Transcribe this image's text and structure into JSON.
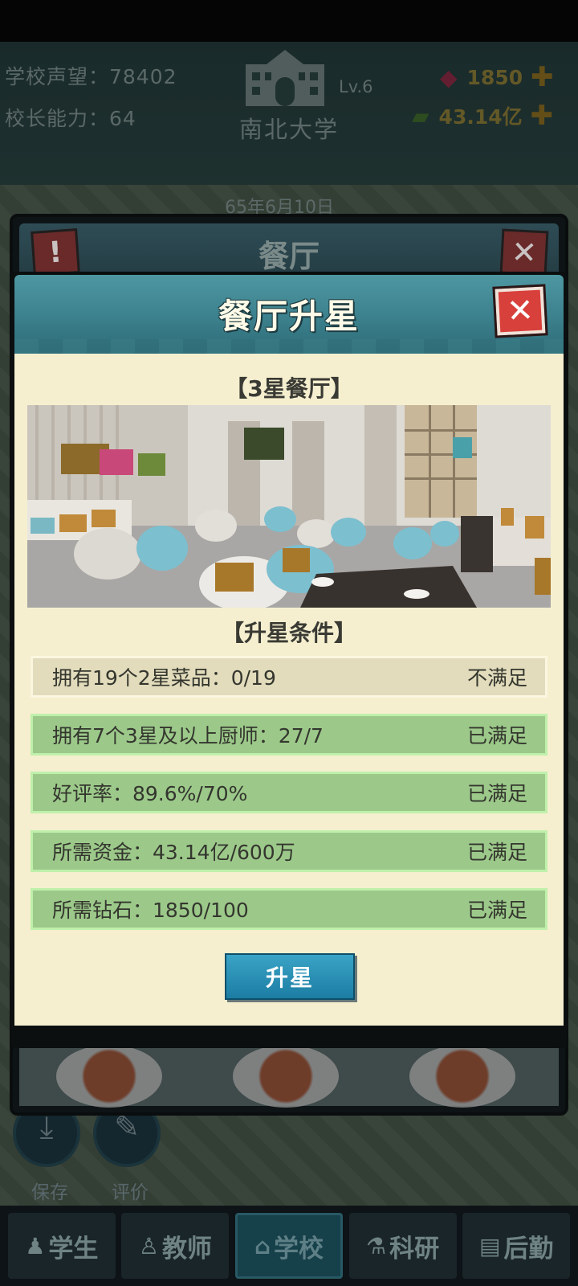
{
  "hud": {
    "reputation": "学校声望：78402",
    "principal_ability": "校长能力：64",
    "school_level": "Lv.6",
    "school_name": "南北大学",
    "diamonds": "1850",
    "money": "43.14亿",
    "date": "65年6月10日"
  },
  "side_buttons": {
    "save_label": "保存",
    "rate_label": "评价"
  },
  "parent_panel": {
    "title": "餐厅",
    "alert_glyph": "!",
    "close_glyph": "✕"
  },
  "modal": {
    "title": "餐厅升星",
    "close_glyph": "✕",
    "star_title": "【3星餐厅】",
    "conditions_title": "【升星条件】",
    "conditions": [
      {
        "text": "拥有19个2星菜品：0/19",
        "status": "不满足",
        "met": false
      },
      {
        "text": "拥有7个3星及以上厨师：27/7",
        "status": "已满足",
        "met": true
      },
      {
        "text": "好评率：89.6%/70%",
        "status": "已满足",
        "met": true
      },
      {
        "text": "所需资金：43.14亿/600万",
        "status": "已满足",
        "met": true
      },
      {
        "text": "所需钻石：1850/100",
        "status": "已满足",
        "met": true
      }
    ],
    "upgrade_label": "升星"
  },
  "bottom_nav": {
    "tabs": [
      {
        "label": "学生",
        "icon": "student-icon"
      },
      {
        "label": "教师",
        "icon": "teacher-icon"
      },
      {
        "label": "学校",
        "icon": "school-icon",
        "active": true
      },
      {
        "label": "科研",
        "icon": "research-icon"
      },
      {
        "label": "后勤",
        "icon": "logistics-icon"
      }
    ]
  },
  "colors": {
    "met_row": "#9cc98a",
    "unmet_row": "#e2dcbc",
    "modal_body": "#f5efcf",
    "header_teal": "#3f8591",
    "close_red": "#d8403c",
    "button_blue": "#1c7da3"
  }
}
